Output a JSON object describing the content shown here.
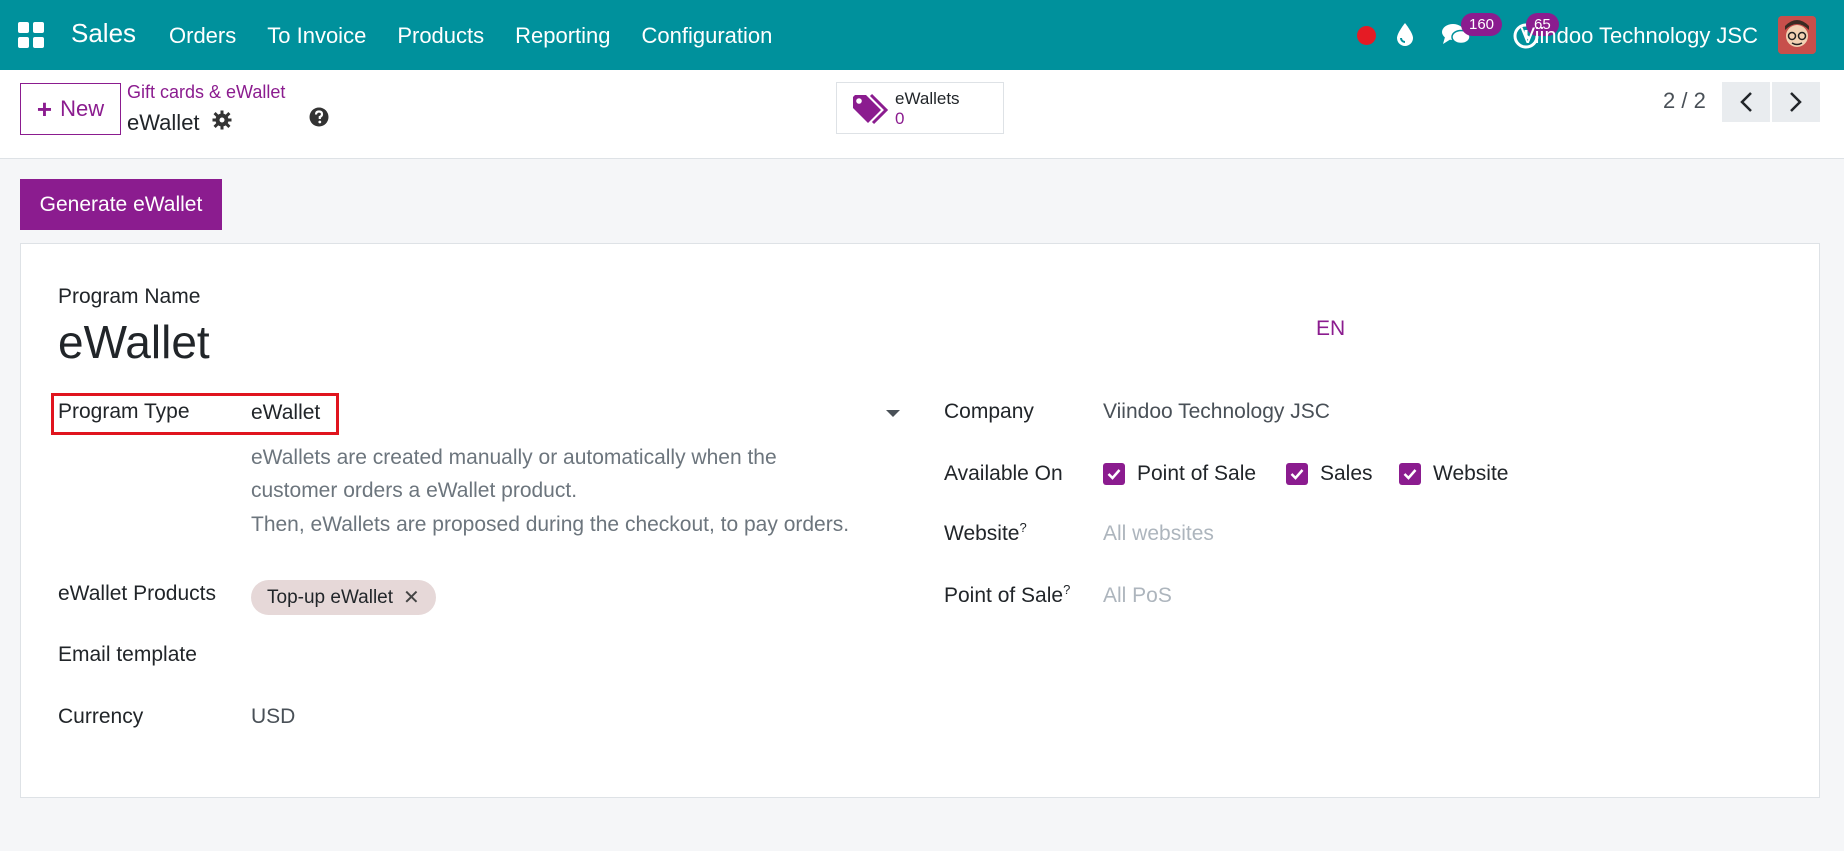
{
  "navbar": {
    "app_name": "Sales",
    "menu": [
      "Orders",
      "To Invoice",
      "Products",
      "Reporting",
      "Configuration"
    ],
    "chat_count": "160",
    "activity_count": "65",
    "company": "Viindoo Technology JSC"
  },
  "control": {
    "new_label": "New",
    "breadcrumb": "Gift cards & eWallet",
    "record_name": "eWallet",
    "stat_label": "eWallets",
    "stat_value": "0",
    "pager": "2 / 2"
  },
  "actions": {
    "generate_label": "Generate eWallet"
  },
  "form": {
    "program_name_label": "Program Name",
    "program_name": "eWallet",
    "lang": "EN",
    "program_type_label": "Program Type",
    "program_type": "eWallet",
    "help_line1": "eWallets are created manually or automatically when the",
    "help_line2": "customer orders a eWallet product.",
    "help_line3": "Then, eWallets are proposed during the checkout, to pay orders.",
    "products_label": "eWallet Products",
    "product_tag": "Top-up eWallet",
    "email_template_label": "Email template",
    "currency_label": "Currency",
    "currency": "USD",
    "company_label": "Company",
    "company": "Viindoo Technology JSC",
    "available_on_label": "Available On",
    "available_on": [
      "Point of Sale",
      "Sales",
      "Website"
    ],
    "website_label": "Website",
    "website_placeholder": "All websites",
    "pos_label": "Point of Sale",
    "pos_placeholder": "All PoS",
    "tooltip_mark": "?"
  },
  "colors": {
    "navbar": "#00919c",
    "primary": "#8b1c8f",
    "highlight": "#e0141e"
  }
}
